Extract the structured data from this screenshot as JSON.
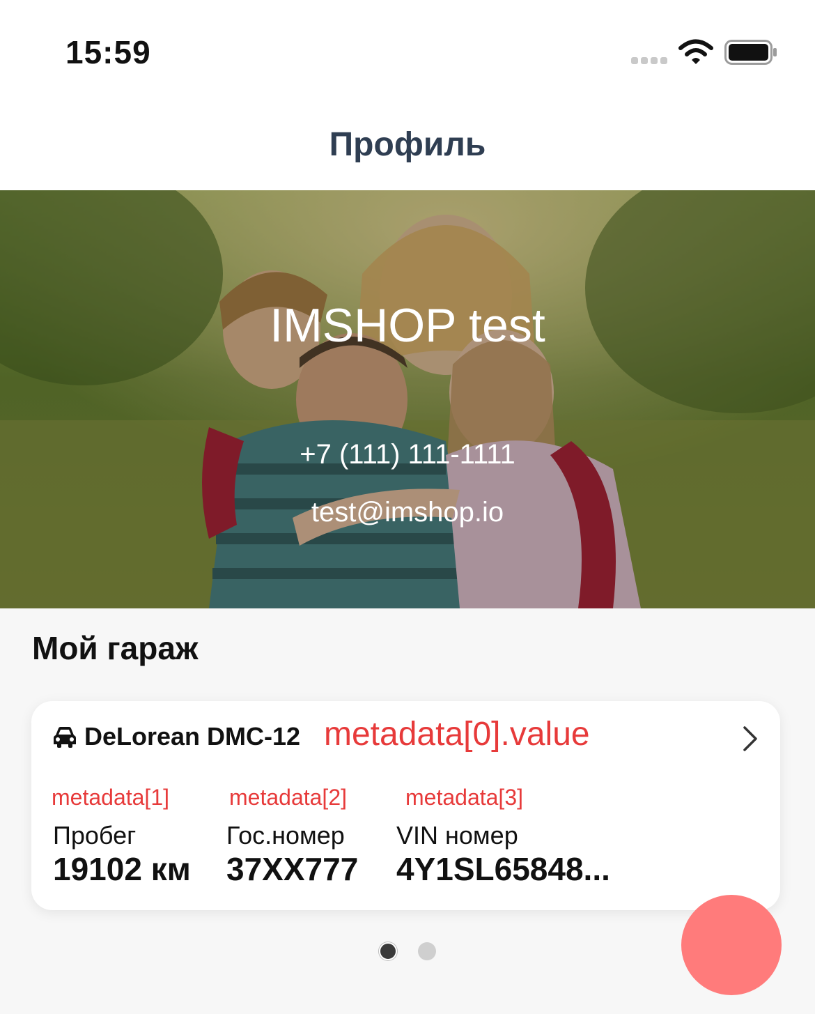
{
  "status_bar": {
    "time": "15:59",
    "icons": [
      "cellular-signal-icon",
      "wifi-icon",
      "battery-icon"
    ]
  },
  "nav": {
    "title": "Профиль"
  },
  "profile": {
    "name": "IMSHOP test",
    "phone": "+7 (111) 111-1111",
    "email": "test@imshop.io",
    "background_image": "family-photo"
  },
  "garage": {
    "title": "Мой гараж",
    "cars": [
      {
        "icon": "car-icon",
        "name": "DeLorean DMC-12",
        "meta_main": "metadata[0].value",
        "fields": [
          {
            "meta": "metadata[1]",
            "label": "Пробег",
            "value": "19102 км"
          },
          {
            "meta": "metadata[2]",
            "label": "Гос.номер",
            "value": "37XX777"
          },
          {
            "meta": "metadata[3]",
            "label": "VIN номер",
            "value": "4Y1SL65848..."
          }
        ]
      }
    ],
    "pager": {
      "pages": 2,
      "active": 1
    }
  },
  "colors": {
    "accent_red": "#e73a3a",
    "fab": "#ff7b7b",
    "nav_title": "#2f3e52",
    "background": "#f7f7f7"
  }
}
